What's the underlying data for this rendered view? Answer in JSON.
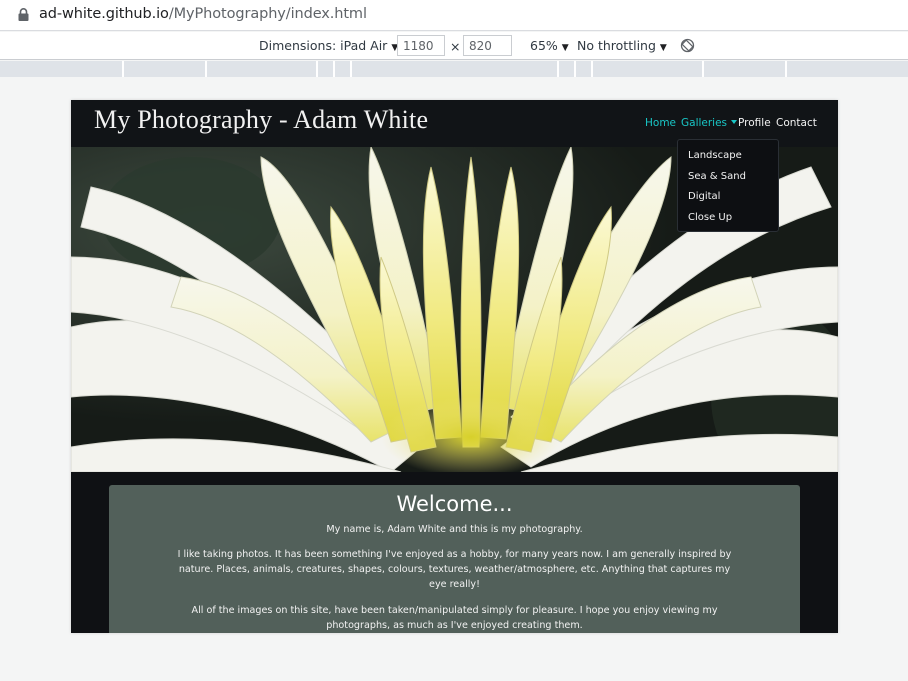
{
  "browser": {
    "url_host": "ad-white.github.io",
    "url_path": "/MyPhotography/index.html"
  },
  "devtools": {
    "dimensions_label": "Dimensions: iPad Air",
    "width_value": "1180",
    "times_sign": "×",
    "height_value": "820",
    "zoom": "65%",
    "throttling": "No throttling",
    "caret": "▼",
    "icons": [
      "lock-icon",
      "rotate-icon"
    ]
  },
  "site": {
    "brand": "My Photography - Adam White",
    "nav": {
      "home": "Home",
      "galleries": "Galleries",
      "profile": "Profile",
      "contact": "Contact"
    },
    "galleries_menu": [
      "Landscape",
      "Sea & Sand",
      "Digital",
      "Close Up"
    ],
    "welcome": {
      "title": "Welcome...",
      "p1": "My name is, Adam White and this is my photography.",
      "p2": "I like taking photos. It has been something I've enjoyed as a hobby, for many years now. I am generally inspired by nature. Places, animals, creatures, shapes, colours, textures, weather/atmosphere, etc. Anything that captures my eye really!",
      "p3": "All of the images on this site, have been taken/manipulated simply for pleasure. I hope you enjoy viewing my photographs, as much as I've enjoyed creating them."
    },
    "colors": {
      "nav_active": "#19c6c6",
      "navbar_bg": "#111417",
      "welcome_bg": "#52605a"
    }
  }
}
